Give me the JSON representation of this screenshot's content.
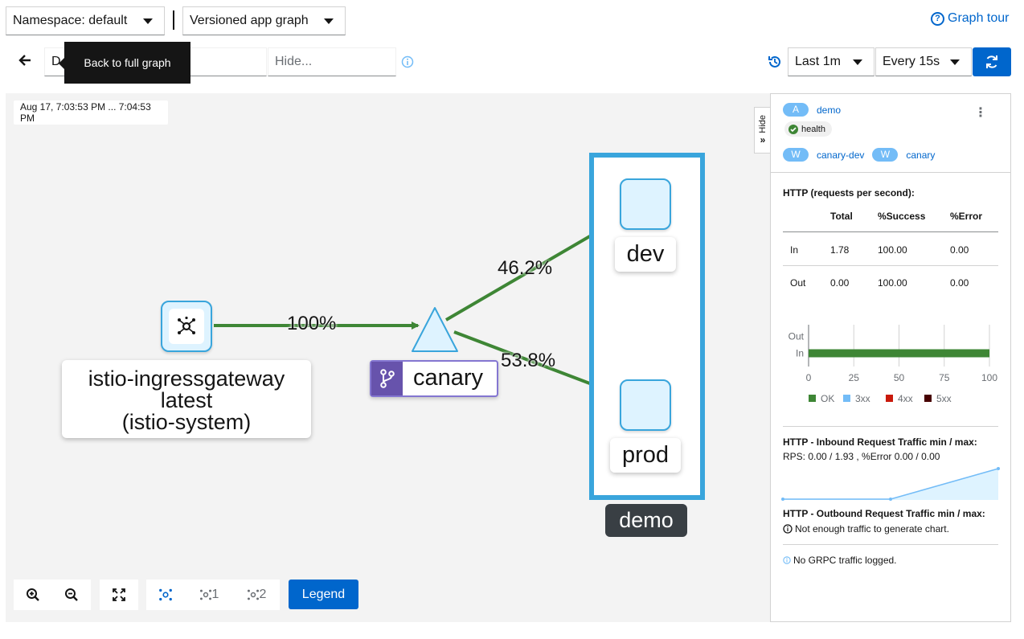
{
  "toolbar": {
    "namespace": "Namespace: default",
    "graph_type": "Versioned app graph",
    "graph_tour": "Graph tour",
    "find_value": "D",
    "hide_placeholder": "Hide...",
    "tooltip": "Back to full graph",
    "duration": "Last 1m",
    "refresh_interval": "Every 15s"
  },
  "graph": {
    "timestamp": "Aug 17, 7:03:53 PM ... 7:04:53 PM",
    "nodes": {
      "gateway": "istio-ingressgateway\nlatest\n(istio-system)",
      "gateway_line1": "istio-ingressgateway",
      "gateway_line2": "latest",
      "gateway_line3": "(istio-system)",
      "service": "canary",
      "dev": "dev",
      "prod": "prod",
      "box": "demo"
    },
    "edges": {
      "gateway_to_canary": "100%",
      "canary_to_dev": "46.2%",
      "canary_to_prod": "53.8%"
    },
    "edge_color": "#3e8635",
    "node_color": "#39a5dc"
  },
  "bottom_toolbar": {
    "layout1": "1",
    "layout2": "2",
    "legend": "Legend"
  },
  "panel": {
    "hide": "Hide",
    "app_badge": "A",
    "app_name": "demo",
    "health": "health",
    "workload_badge": "W",
    "workload1": "canary-dev",
    "workload2": "canary",
    "http_title": "HTTP (requests per second):",
    "table": {
      "headers": [
        "",
        "Total",
        "%Success",
        "%Error"
      ],
      "rows": [
        [
          "In",
          "1.78",
          "100.00",
          "0.00"
        ],
        [
          "Out",
          "0.00",
          "100.00",
          "0.00"
        ]
      ]
    },
    "chart_data": {
      "type": "bar",
      "categories": [
        "Out",
        "In"
      ],
      "series": [
        {
          "name": "OK",
          "values": [
            0,
            100
          ]
        },
        {
          "name": "3xx",
          "values": [
            0,
            0
          ]
        },
        {
          "name": "4xx",
          "values": [
            0,
            0
          ]
        },
        {
          "name": "5xx",
          "values": [
            0,
            0
          ]
        }
      ],
      "xticks": [
        "0",
        "25",
        "50",
        "75",
        "100"
      ],
      "xlim": [
        0,
        100
      ],
      "colors": [
        "#3e8635",
        "#73bcf7",
        "#c9190b",
        "#470000"
      ]
    },
    "inbound_title": "HTTP - Inbound Request Traffic min / max:",
    "inbound_stats": "RPS: 0.00 / 1.93 , %Error 0.00 / 0.00",
    "outbound_title": "HTTP - Outbound Request Traffic min / max:",
    "outbound_msg": "Not enough traffic to generate chart.",
    "grpc_msg": "No GRPC traffic logged."
  }
}
